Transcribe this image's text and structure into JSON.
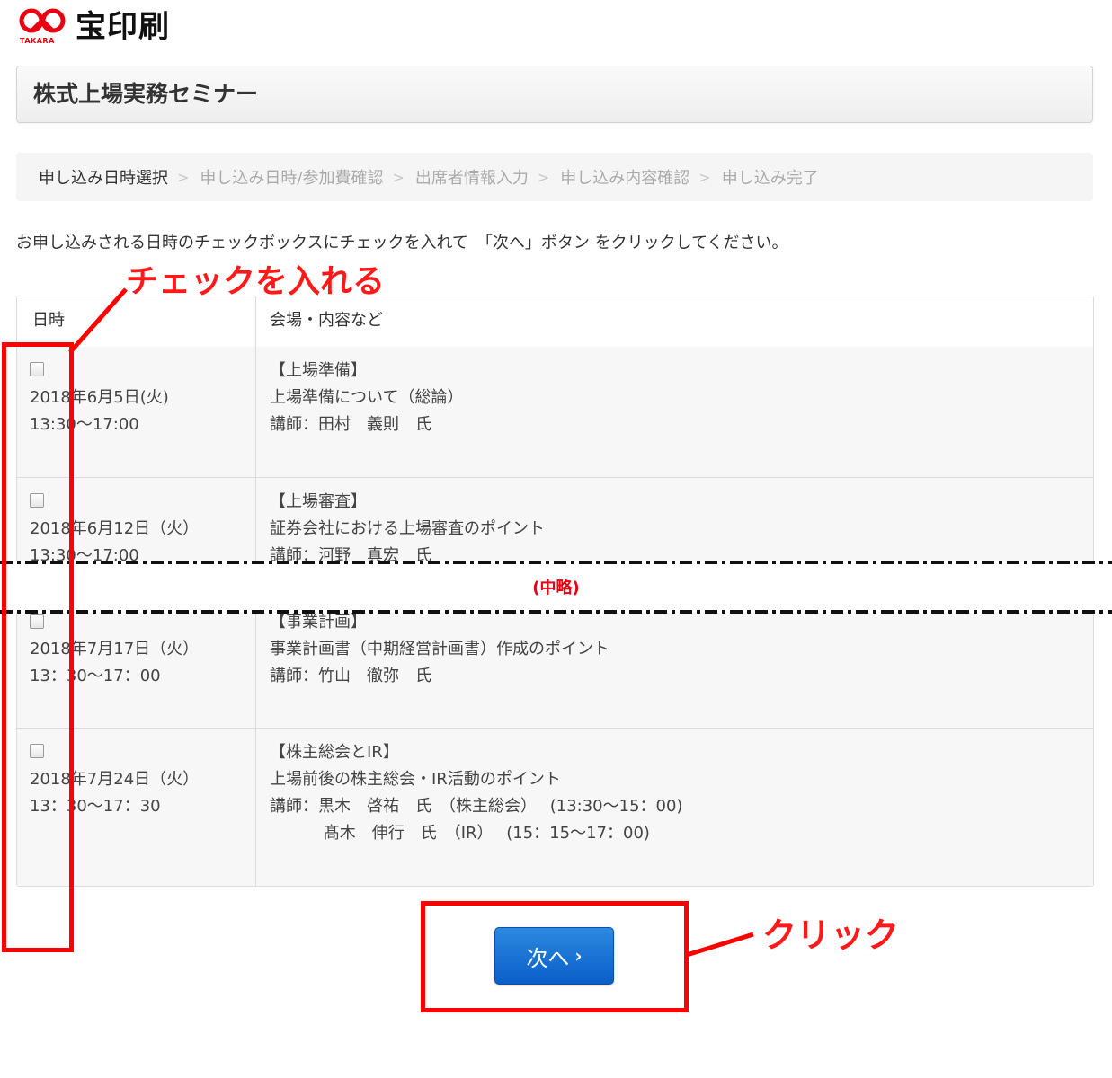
{
  "logo": {
    "brand": "宝印刷",
    "sub": "TAKARA",
    "colors": {
      "mark": "#e60012",
      "text": "#111111"
    }
  },
  "title": "株式上場実務セミナー",
  "breadcrumb": [
    "申し込み日時選択",
    "申し込み日時/参加費確認",
    "出席者情報入力",
    "申し込み内容確認",
    "申し込み完了"
  ],
  "instruction": "お申し込みされる日時のチェックボックスにチェックを入れて　「次へ」ボタン をクリックしてください。",
  "table": {
    "headers": [
      "日時",
      "会場・内容など"
    ],
    "rows": [
      {
        "checked": false,
        "date": "2018年6月5日(火)",
        "time": "13:30〜17:00",
        "lines": [
          "【上場準備】",
          "上場準備について（総論）",
          "講師：田村　義則　氏"
        ]
      },
      {
        "checked": false,
        "date": "2018年6月12日（火）",
        "time": "13:30〜17:00",
        "lines": [
          "【上場審査】",
          "証券会社における上場審査のポイント",
          "講師：河野　真宏　氏"
        ]
      },
      {
        "checked": false,
        "date": "2018年7月17日（火）",
        "time": "13：30〜17：00",
        "lines": [
          "【事業計画】",
          "事業計画書（中期経営計画書）作成のポイント",
          "講師：竹山　徹弥　氏"
        ]
      },
      {
        "checked": false,
        "date": "2018年7月24日（火）",
        "time": "13：30〜17：30",
        "lines": [
          "【株主総会とIR】",
          "上場前後の株主総会・IR活動のポイント",
          "講師：黒木　啓祐　氏　（株主総会）　 (13:30〜15：00)",
          "　　　 髙木　伸行　氏　（IR）　 (15：15〜17：00)"
        ]
      }
    ]
  },
  "omitted_label": "(中略)",
  "next_button": {
    "label": "次へ",
    "icon": "chevron-right-icon",
    "color": "#0b5ec8"
  },
  "annotations": {
    "check": "チェックを入れる",
    "click": "クリック",
    "color": "#ff0000"
  }
}
